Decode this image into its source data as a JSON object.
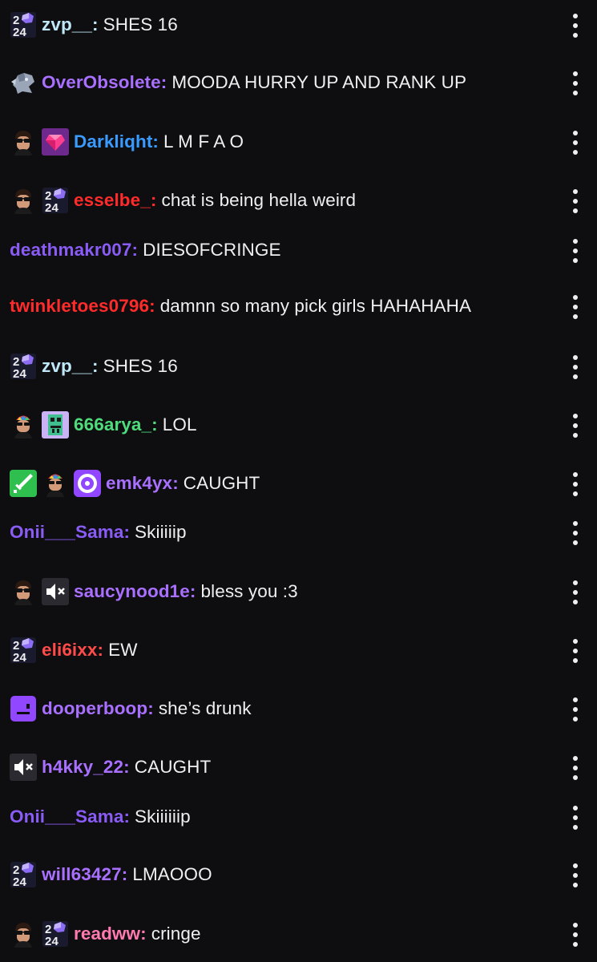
{
  "messages": [
    {
      "badges": [
        "2024-badge"
      ],
      "user": "zvp__",
      "sep": ":",
      "text": "SHES 16",
      "color": "#bfe7f7"
    },
    {
      "badges": [
        "gargoyle-badge"
      ],
      "user": "OverObsolete",
      "sep": ":",
      "text": "MOODA HURRY UP AND RANK UP",
      "color": "#a970ff"
    },
    {
      "badges": [
        "avatar-sunglasses-badge",
        "pink-gem-badge"
      ],
      "user": "Darkliqht",
      "sep": ":",
      "text": "L M F A O",
      "color": "#3a9bff"
    },
    {
      "badges": [
        "avatar-sunglasses-badge",
        "2024-badge"
      ],
      "user": "esselbe_",
      "sep": ":",
      "text": "chat is being hella weird",
      "color": "#ff2b2b"
    },
    {
      "badges": [],
      "user": "deathmakr007",
      "sep": ":",
      "text": "DIESOFCRINGE",
      "color": "#8a5cf6"
    },
    {
      "badges": [],
      "user": "twinkletoes0796",
      "sep": ":",
      "text": "damnn so many pick girls HAHAHAHA",
      "color": "#ff2b2b"
    },
    {
      "badges": [
        "2024-badge"
      ],
      "user": "zvp__",
      "sep": ":",
      "text": "SHES 16",
      "color": "#bfe7f7"
    },
    {
      "badges": [
        "avatar-propeller-hat-badge",
        "pixel-monster-badge"
      ],
      "user": "666arya_",
      "sep": ":",
      "text": "LOL",
      "color": "#4fdc7c"
    },
    {
      "badges": [
        "green-sword-badge",
        "avatar-propeller-hat-badge",
        "purple-disc-badge"
      ],
      "user": "emk4yx",
      "sep": ":",
      "text": "CAUGHT",
      "color": "#a970ff"
    },
    {
      "badges": [],
      "user": "Onii___Sama",
      "sep": ":",
      "text": "Skiiiiip",
      "color": "#8a5cf6"
    },
    {
      "badges": [
        "avatar-sunglasses-badge",
        "muted-speaker-badge"
      ],
      "user": "saucynood1e",
      "sep": ":",
      "text": "bless you :3",
      "color": "#a970ff"
    },
    {
      "badges": [
        "2024-badge"
      ],
      "user": "eli6ixx",
      "sep": ":",
      "text": "EW",
      "color": "#ff4a4a"
    },
    {
      "badges": [
        "purple-face-badge"
      ],
      "user": "dooperboop",
      "sep": ":",
      "text": "she’s drunk",
      "color": "#a970ff"
    },
    {
      "badges": [
        "muted-speaker-badge"
      ],
      "user": "h4kky_22",
      "sep": ":",
      "text": "CAUGHT",
      "color": "#a970ff"
    },
    {
      "badges": [],
      "user": "Onii___Sama",
      "sep": ":",
      "text": "Skiiiiiip",
      "color": "#8a5cf6"
    },
    {
      "badges": [
        "2024-badge"
      ],
      "user": "will63427",
      "sep": ":",
      "text": "LMAOOO",
      "color": "#a970ff"
    },
    {
      "badges": [
        "avatar-sunglasses-badge",
        "2024-badge"
      ],
      "user": "readww",
      "sep": ":",
      "text": "cringe",
      "color": "#ff7ab0"
    }
  ]
}
